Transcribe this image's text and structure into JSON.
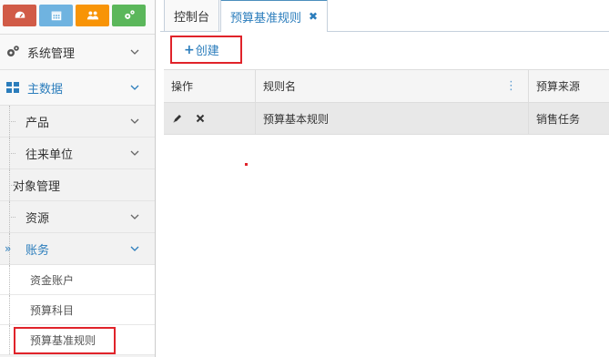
{
  "shortcuts": [
    {
      "icon": "dashboard-icon",
      "color": "#d15b47"
    },
    {
      "icon": "calendar-icon",
      "color": "#6fb3e0"
    },
    {
      "icon": "users-icon",
      "color": "#f89406"
    },
    {
      "icon": "cogs-icon",
      "color": "#5bb75b"
    }
  ],
  "sidebar": {
    "system": {
      "label": "系统管理",
      "icon": "cogs-icon"
    },
    "master": {
      "label": "主数据",
      "icon": "grid-icon"
    },
    "sub": [
      {
        "label": "产品"
      },
      {
        "label": "往来单位"
      },
      {
        "label": "对象管理"
      },
      {
        "label": "资源"
      },
      {
        "label": "账务"
      }
    ],
    "leaves": [
      {
        "label": "资金账户"
      },
      {
        "label": "预算科目"
      },
      {
        "label": "预算基准规则"
      }
    ]
  },
  "tabs": [
    {
      "label": "控制台"
    },
    {
      "label": "预算基准规则",
      "close": "✖"
    }
  ],
  "toolbar": {
    "create_label": "创建",
    "create_icon": "+"
  },
  "grid": {
    "columns": [
      "操作",
      "规则名",
      "预算来源"
    ],
    "rows": [
      {
        "name": "预算基本规则",
        "source": "销售任务"
      }
    ]
  },
  "colors": {
    "accent": "#2b7dbc",
    "highlight": "#e0232a"
  }
}
